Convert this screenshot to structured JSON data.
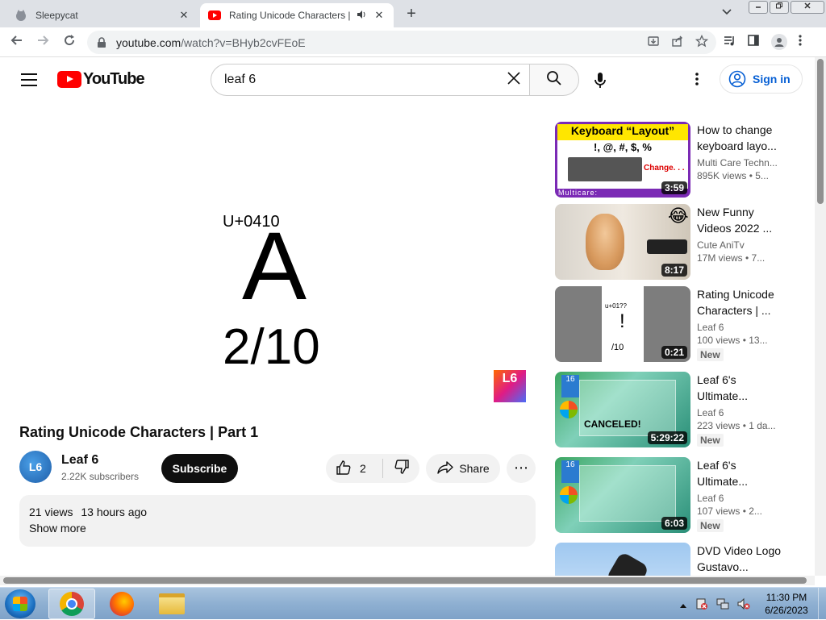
{
  "browser": {
    "tabs": [
      {
        "title": "Sleepycat",
        "active": false
      },
      {
        "title": "Rating Unicode Characters | ",
        "active": true
      }
    ],
    "new_tab": "+",
    "close_glyph": "✕",
    "url_host": "youtube.com",
    "url_path": "/watch?v=BHyb2cvFEoE"
  },
  "youtube": {
    "logo_text": "YouTube",
    "search_query": "leaf 6",
    "signin_label": "Sign in"
  },
  "video": {
    "frame": {
      "code": "U+0410",
      "character": "A",
      "rating": "2/10",
      "watermark": "L6"
    },
    "title": "Rating Unicode Characters | Part 1",
    "channel": {
      "avatar_text": "L6",
      "name": "Leaf 6",
      "subscribers": "2.22K subscribers"
    },
    "subscribe_label": "Subscribe",
    "like_count": "2",
    "share_label": "Share",
    "more_glyph": "⋯",
    "description": {
      "views": "21 views",
      "age": "13 hours ago",
      "show_more": "Show more"
    }
  },
  "recommendations": [
    {
      "title": "How to change keyboard layo...",
      "channel": "Multi Care Techn...",
      "meta": "895K views  •  5...",
      "duration": "3:59",
      "new": "",
      "thumb_text": {
        "heading": "Keyboard “Layout”",
        "symbols": "!, @, #, $, %",
        "change": "Change. . .",
        "brand": "Multicare:"
      }
    },
    {
      "title": "New Funny Videos 2022 ...",
      "channel": "Cute AniTv",
      "meta": "17M views  •  7...",
      "duration": "8:17",
      "new": "",
      "thumb_text": {
        "emoji": "😂"
      }
    },
    {
      "title": "Rating Unicode Characters | ...",
      "channel": "Leaf 6",
      "meta": "100 views  •  13...",
      "duration": "0:21",
      "new": "New",
      "thumb_text": {
        "code": "u+01??",
        "char": "!",
        "rating": "/10"
      }
    },
    {
      "title": "Leaf 6's Ultimate...",
      "channel": "Leaf 6",
      "meta": "223 views  •  1 da...",
      "duration": "5:29:22",
      "new": "New",
      "thumb_text": {
        "logo": "16",
        "overlay": "CANCELED!"
      }
    },
    {
      "title": "Leaf 6's Ultimate...",
      "channel": "Leaf 6",
      "meta": "107 views  •  2...",
      "duration": "6:03",
      "new": "New",
      "thumb_text": {
        "logo": "16"
      }
    },
    {
      "title": "DVD Video Logo Gustavo...",
      "channel": "",
      "meta": "",
      "duration": "",
      "new": ""
    }
  ],
  "taskbar": {
    "time": "11:30 PM",
    "date": "6/26/2023"
  },
  "colors": {
    "yt_red": "#ff0000",
    "link_blue": "#065fd4",
    "subscribe_bg": "#0f0f0f"
  },
  "icons": [
    "sleepycat-favicon-icon",
    "youtube-favicon-icon",
    "speaker-icon",
    "back-icon",
    "forward-icon",
    "reload-icon",
    "lock-icon",
    "install-icon",
    "share-page-icon",
    "bookmark-star-icon",
    "media-icon",
    "sidepanel-icon",
    "profile-icon",
    "kebab-icon",
    "hamburger-icon",
    "search-icon",
    "clear-icon",
    "mic-icon",
    "user-circle-icon",
    "like-icon",
    "dislike-icon",
    "share-icon"
  ]
}
